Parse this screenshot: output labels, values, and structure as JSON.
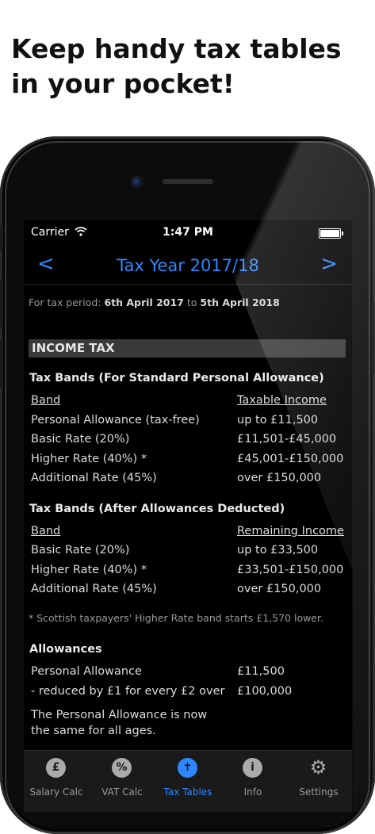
{
  "headline": "Keep handy tax tables in your pocket!",
  "status": {
    "carrier": "Carrier",
    "time": "1:47 PM"
  },
  "nav": {
    "title": "Tax Year 2017/18",
    "prev": "<",
    "next": ">"
  },
  "period": {
    "prefix": "For tax period:",
    "start": "6th April 2017",
    "joiner": "to",
    "end": "5th April 2018"
  },
  "income_tax": {
    "header": "INCOME TAX",
    "standard": {
      "title": "Tax Bands (For Standard Personal Allowance)",
      "col1": "Band",
      "col2": "Taxable Income",
      "rows": [
        {
          "band": "Personal Allowance (tax-free)",
          "value": "up to £11,500"
        },
        {
          "band": "Basic Rate (20%)",
          "value": "£11,501-£45,000"
        },
        {
          "band": "Higher Rate (40%) *",
          "value": "£45,001-£150,000"
        },
        {
          "band": "Additional Rate (45%)",
          "value": "over £150,000"
        }
      ]
    },
    "after": {
      "title": "Tax Bands (After Allowances Deducted)",
      "col1": "Band",
      "col2": "Remaining Income",
      "rows": [
        {
          "band": "Basic Rate (20%)",
          "value": "up to £33,500"
        },
        {
          "band": "Higher Rate (40%) *",
          "value": "£33,501-£150,000"
        },
        {
          "band": "Additional Rate (45%)",
          "value": "over £150,000"
        }
      ]
    },
    "note": "* Scottish taxpayers' Higher Rate band starts £1,570 lower.",
    "allowances": {
      "title": "Allowances",
      "rows": [
        {
          "label": "Personal Allowance",
          "value": "£11,500"
        },
        {
          "label": "- reduced by £1 for every £2 over",
          "value": "£100,000"
        }
      ],
      "para": "The Personal Allowance is now the same for all ages."
    }
  },
  "tabs": [
    {
      "label": "Salary Calc",
      "icon": "pound-icon",
      "glyph": "£"
    },
    {
      "label": "VAT Calc",
      "icon": "percent-icon",
      "glyph": "%"
    },
    {
      "label": "Tax Tables",
      "icon": "tax-tables-icon",
      "glyph": "✝"
    },
    {
      "label": "Info",
      "icon": "info-icon",
      "glyph": "i"
    },
    {
      "label": "Settings",
      "icon": "gear-icon",
      "glyph": "⚙"
    }
  ],
  "colors": {
    "accent": "#2e87ff",
    "background": "#000000",
    "section": "#3a3a3a"
  }
}
